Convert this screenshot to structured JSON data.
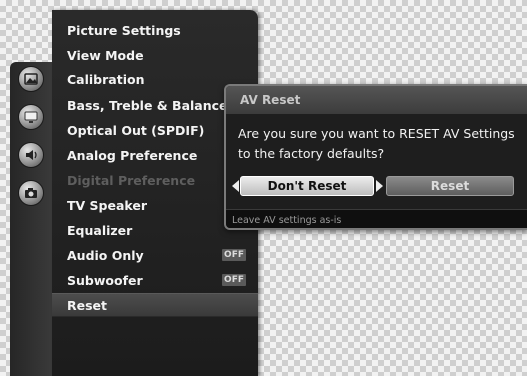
{
  "menu": {
    "items": [
      {
        "label": "Picture Settings",
        "state": "normal"
      },
      {
        "label": "View Mode",
        "state": "normal"
      },
      {
        "label": "Calibration",
        "state": "normal"
      },
      {
        "label": "Bass, Treble & Balance",
        "state": "normal"
      },
      {
        "label": "Optical Out (SPDIF)",
        "state": "normal"
      },
      {
        "label": "Analog Preference",
        "state": "normal"
      },
      {
        "label": "Digital Preference",
        "state": "disabled"
      },
      {
        "label": "TV Speaker",
        "state": "normal"
      },
      {
        "label": "Equalizer",
        "state": "normal"
      },
      {
        "label": "Audio Only",
        "state": "normal",
        "toggle": "OFF"
      },
      {
        "label": "Subwoofer",
        "state": "normal",
        "toggle": "OFF"
      },
      {
        "label": "Reset",
        "state": "selected"
      }
    ]
  },
  "categories": {
    "icons": [
      "picture-icon",
      "tv-screen-icon",
      "audio-speaker-icon",
      "camera-icon"
    ]
  },
  "dialog": {
    "title": "AV Reset",
    "message_line1": "Are you sure you want to RESET AV Settings",
    "message_line2": "to the factory defaults?",
    "dont_reset_label": "Don't Reset",
    "reset_label": "Reset",
    "footer_hint": "Leave AV settings as-is"
  },
  "colors": {
    "menu_bg": "#1c1c1c",
    "dialog_bg": "#1e1e1e",
    "focused_button": "#e0e0e0",
    "disabled_text": "#5e5e5e"
  }
}
